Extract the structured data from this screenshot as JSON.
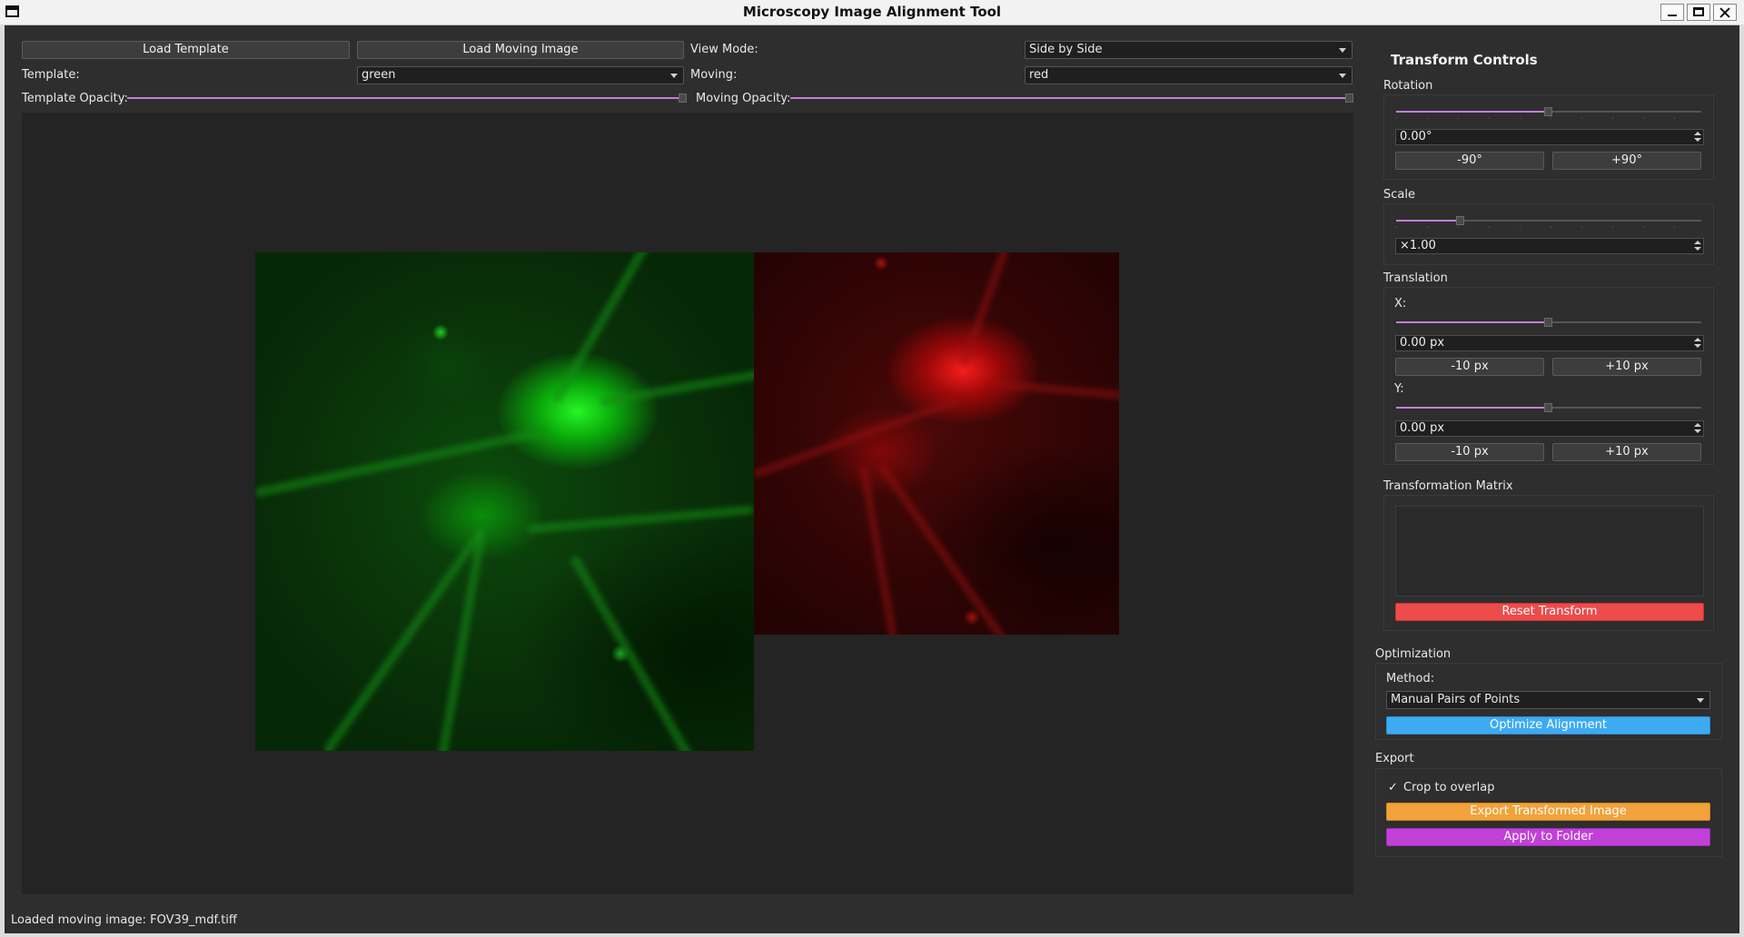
{
  "window": {
    "title": "Microscopy Image Alignment Tool"
  },
  "toolbar": {
    "load_template": "Load Template",
    "load_moving": "Load Moving Image",
    "view_mode_label": "View Mode:",
    "view_mode_value": "Side by Side",
    "template_label": "Template:",
    "template_color": "green",
    "moving_label": "Moving:",
    "moving_color": "red",
    "template_opacity_label": "Template Opacity:",
    "template_opacity": 1.0,
    "moving_opacity_label": "Moving Opacity:",
    "moving_opacity": 1.0
  },
  "panel": {
    "title": "Transform Controls",
    "rotation": {
      "label": "Rotation",
      "value": "0.00°",
      "slider_level": 0.5,
      "minus": "-90°",
      "plus": "+90°"
    },
    "scale": {
      "label": "Scale",
      "value": "×1.00",
      "slider_level": 0.21
    },
    "translation": {
      "label": "Translation",
      "x_label": "X:",
      "x_value": "0.00 px",
      "x_level": 0.5,
      "y_label": "Y:",
      "y_value": "0.00 px",
      "y_level": 0.5,
      "minus": "-10 px",
      "plus": "+10 px"
    },
    "matrix": {
      "label": "Transformation Matrix",
      "reset": "Reset Transform"
    },
    "optimization": {
      "label": "Optimization",
      "method_label": "Method:",
      "method_value": "Manual Pairs of Points",
      "optimize": "Optimize Alignment"
    },
    "export": {
      "label": "Export",
      "crop_checked": true,
      "crop_label": "Crop to overlap",
      "export_btn": "Export Transformed Image",
      "folder_btn": "Apply to Folder"
    }
  },
  "status": {
    "text": "Loaded moving image: FOV39_mdf.tiff"
  },
  "colors": {
    "accent": "#c77ddb",
    "reset": "#ee4b4b",
    "optimize": "#3daaf2",
    "export": "#f2a23a",
    "folder": "#c040d8"
  }
}
